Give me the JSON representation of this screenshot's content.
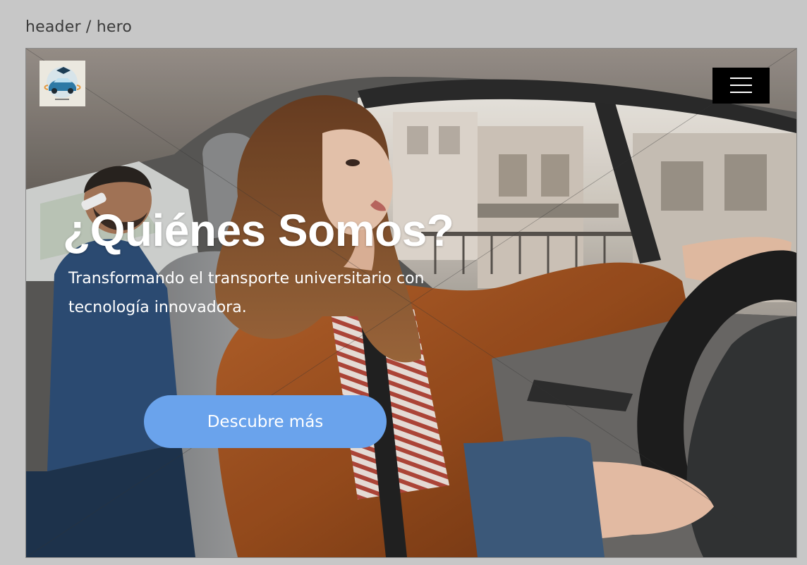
{
  "frame": {
    "label": "header / hero"
  },
  "header": {
    "logo_alt": "logo",
    "menu_icon": "hamburger-menu-icon"
  },
  "hero": {
    "title": "¿Quiénes Somos?",
    "subtitle": "Transformando el transporte universitario con tecnología innovadora.",
    "cta_label": "Descubre más",
    "background": "photo of a woman driving a car with a passenger on the phone in the back seat"
  },
  "colors": {
    "page_bg": "#c7c7c7",
    "cta_bg": "#6aa3ec",
    "menu_bg": "#000000",
    "text": "#ffffff"
  }
}
